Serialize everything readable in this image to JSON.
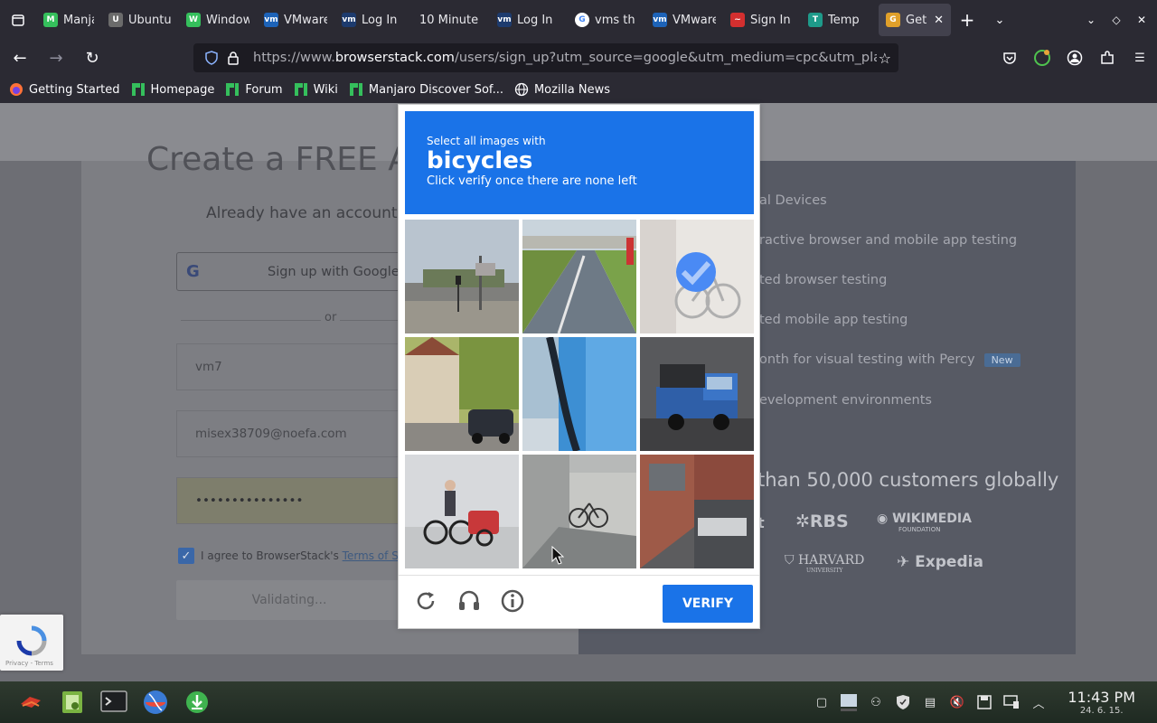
{
  "browser": {
    "tabs": [
      {
        "label": "Manjaro",
        "fav_color": "#35bf5c",
        "fav": "M"
      },
      {
        "label": "Ubuntu",
        "fav_color": "#6b6b6b",
        "fav": "U"
      },
      {
        "label": "Windows",
        "fav_color": "#35bf5c",
        "fav": "W"
      },
      {
        "label": "VMware",
        "fav_color": "#1d63b8",
        "fav": "vm"
      },
      {
        "label": "Log In",
        "fav_color": "#1d3b6e",
        "fav": "vm"
      },
      {
        "label": "10 Minute",
        "fav_color": "",
        "fav": ""
      },
      {
        "label": "Log In",
        "fav_color": "#1d3b6e",
        "fav": "vm"
      },
      {
        "label": "vms th",
        "fav_color": "#ffffff",
        "fav": "G"
      },
      {
        "label": "VMware",
        "fav_color": "#1d63b8",
        "fav": "vm"
      },
      {
        "label": "Sign In",
        "fav_color": "#d32f2f",
        "fav": "~"
      },
      {
        "label": "Temp",
        "fav_color": "#1e9a8a",
        "fav": "T"
      },
      {
        "label": "Get",
        "fav_color": "#e0a02a",
        "fav": "G"
      }
    ],
    "url_prefix": "https://www.",
    "url_domain": "browserstack.com",
    "url_rest": "/users/sign_up?utm_source=google&utm_medium=cpc&utm_platform=p",
    "bookmarks": [
      {
        "label": "Getting Started",
        "icon": "firefox-icon"
      },
      {
        "label": "Homepage",
        "icon": "manjaro-icon"
      },
      {
        "label": "Forum",
        "icon": "manjaro-icon"
      },
      {
        "label": "Wiki",
        "icon": "manjaro-icon"
      },
      {
        "label": "Manjaro Discover Sof...",
        "icon": "manjaro-icon"
      },
      {
        "label": "Mozilla News",
        "icon": "globe-icon"
      }
    ]
  },
  "page": {
    "create_title": "Create a FREE A",
    "already": "Already have an account?",
    "google_btn": "Sign up with Google",
    "or": "or",
    "name_value": "vm7",
    "email_value": "misex38709@noefa.com",
    "password_value": "•••••••••••••••",
    "agree_text": "I agree to BrowserStack's ",
    "terms_link": "Terms of Service",
    "validating": "Validating...",
    "features": [
      {
        "text": "al Devices"
      },
      {
        "text": "ractive browser and mobile app testing"
      },
      {
        "text": "ted browser testing"
      },
      {
        "text": "ted mobile app testing"
      },
      {
        "text": "onth for visual testing with Percy"
      },
      {
        "text": "evelopment environments"
      }
    ],
    "new_badge": "New",
    "customers": "than 50,000 customers globally",
    "logo_rbs": "RBS",
    "logo_wikimedia": "WIKIMEDIA",
    "logo_wikimedia_sub": "FOUNDATION",
    "logo_harvard": "HARVARD",
    "logo_harvard_sub": "UNIVERSITY",
    "logo_expedia": "Expedia",
    "logo_partial": "t",
    "recaptcha_badge_text": "Privacy - Terms"
  },
  "captcha": {
    "instruction_line1": "Select all images with",
    "target": "bicycles",
    "instruction_line3": "Click verify once there are none left",
    "verify_label": "VERIFY",
    "selected_tile": 2
  },
  "taskbar": {
    "time": "11:43 PM",
    "date": "24. 6. 15."
  }
}
